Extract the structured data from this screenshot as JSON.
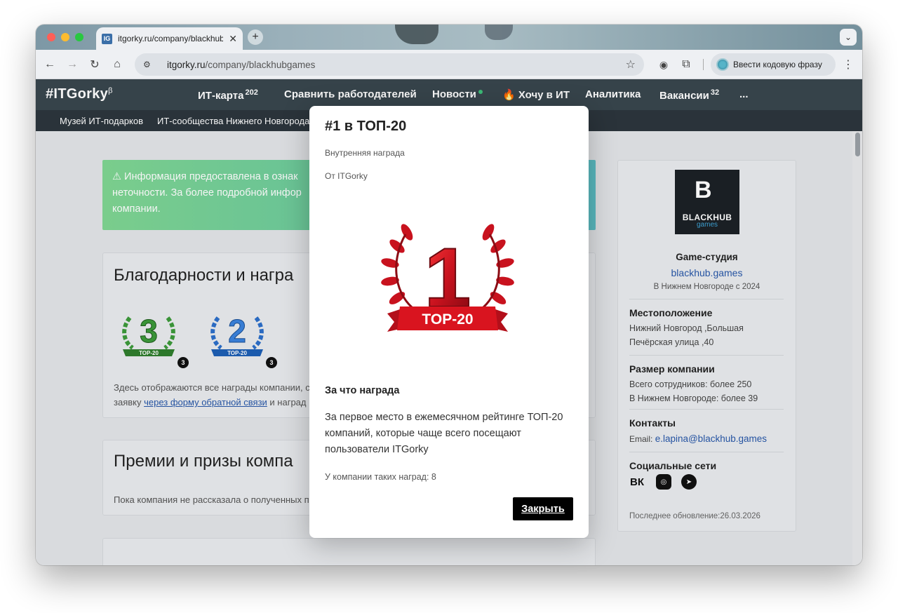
{
  "browser": {
    "tab_title": "itgorky.ru/company/blackhub",
    "tab_favicon": "IG",
    "url_host": "itgorky.ru",
    "url_path": "/company/blackhubgames",
    "passphrase_label": "Ввести кодовую фразу"
  },
  "site": {
    "logo": "#ITGorky",
    "logo_suffix": "β",
    "nav": [
      {
        "label": "ИТ-карта",
        "count": "202"
      },
      {
        "label": "Сравнить работодателей"
      },
      {
        "label": "Новости"
      },
      {
        "label": "🔥 Хочу в ИТ"
      },
      {
        "label": "Аналитика"
      },
      {
        "label": "Вакансии",
        "count": "32"
      },
      {
        "label": "..."
      }
    ],
    "subnav": [
      "Музей ИТ-подарков",
      "ИТ-сообщества Нижнего Новгорода"
    ]
  },
  "page": {
    "alert_text_1": "⚠ Информация предоставлена в ознак",
    "alert_text_2": "неточности. За более подробной инфор",
    "alert_text_3": "компании.",
    "awards_title": "Благодарности и награ",
    "award_badges": [
      {
        "place": "3",
        "label": "TOP-20",
        "count": "3",
        "color": "#3c9a3a"
      },
      {
        "place": "2",
        "label": "TOP-20",
        "count": "3",
        "color": "#2c6fc9"
      }
    ],
    "awards_note_1": "Здесь отображаются все награды компании, с",
    "awards_note_2_pre": "заявку ",
    "awards_note_2_link": "через форму обратной связи",
    "awards_note_2_post": " и наград",
    "prizes_title": "Премии и призы компа",
    "prizes_note": "Пока компания не рассказала о полученных п"
  },
  "sidebar": {
    "logo_name": "BLACKHUB",
    "logo_sub": "games",
    "company_type": "Game-студия",
    "website": "blackhub.games",
    "since": "В Нижнем Новгороде с 2024",
    "location_h": "Местоположение",
    "location_1": "Нижний Новгород ,Большая",
    "location_2": "Печёрская улица ,40",
    "size_h": "Размер компании",
    "size_1": "Всего сотрудников: более 250",
    "size_2": "В Нижнем Новгороде: более 39",
    "contacts_h": "Контакты",
    "email_label": "Email: ",
    "email": "e.lapina@blackhub.games",
    "social_h": "Социальные сети",
    "social": [
      "vk-icon",
      "instagram-icon",
      "telegram-icon"
    ],
    "updated": "Последнее обновление:26.03.2026"
  },
  "modal": {
    "title": "#1 в ТОП-20",
    "type": "Внутренняя награда",
    "from": "От ITGorky",
    "award_place": "1",
    "award_label": "TOP-20",
    "reason_h": "За что награда",
    "reason_text": "За первое место в ежемесячном рейтинге ТОП-20 компаний, которые чаще всего посещают пользователи ITGorky",
    "count_text": "У компании таких наград: 8",
    "close_label": "Закрыть"
  },
  "colors": {
    "award_red": "#c8121e",
    "nav_bg": "#39464e",
    "link": "#2757a8"
  }
}
